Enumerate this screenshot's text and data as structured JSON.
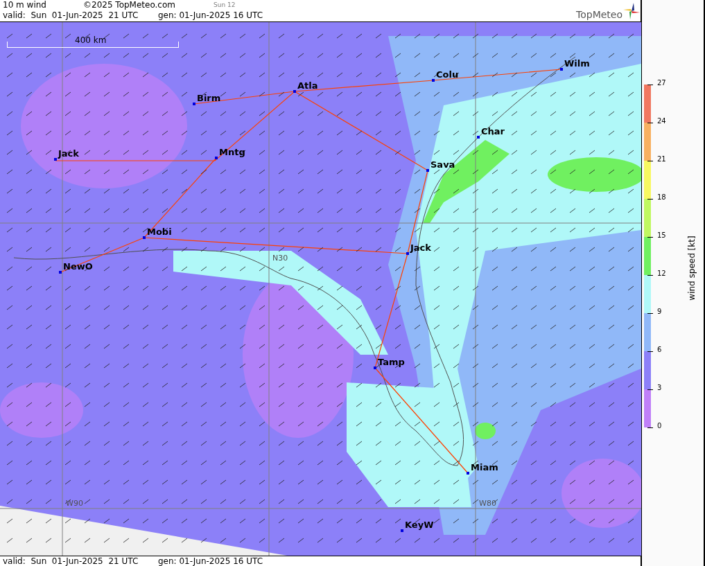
{
  "header": {
    "title": "10 m wind",
    "copyright": "©2025 TopMeteo.com",
    "step": "Sun 12",
    "valid": "valid:  Sun  01-Jun-2025  21 UTC",
    "generated": "gen: 01-Jun-2025 16 UTC",
    "logo": "TopMeteo"
  },
  "map": {
    "scale": "400 km",
    "cities": [
      {
        "name": "Atla"
      },
      {
        "name": "Colu"
      },
      {
        "name": "Wilm"
      },
      {
        "name": "Birm"
      },
      {
        "name": "Char"
      },
      {
        "name": "Jack"
      },
      {
        "name": "Mntg"
      },
      {
        "name": "Sava"
      },
      {
        "name": "Mobi"
      },
      {
        "name": "Jack"
      },
      {
        "name": "NewO"
      },
      {
        "name": "Tamp"
      },
      {
        "name": "Miam"
      },
      {
        "name": "KeyW"
      }
    ],
    "gridlabels": [
      "N30",
      "W90",
      "W80"
    ]
  },
  "colorbar": {
    "label": "wind speed [kt]",
    "ticks": [
      "27",
      "24",
      "21",
      "18",
      "15",
      "12",
      "9",
      "6",
      "3",
      "0"
    ],
    "bands": [
      {
        "color": "#f07860"
      },
      {
        "color": "#f8b060"
      },
      {
        "color": "#f8f860"
      },
      {
        "color": "#c0f860"
      },
      {
        "color": "#70f060"
      },
      {
        "color": "#b0f8f8"
      },
      {
        "color": "#90b8f8"
      },
      {
        "color": "#8c80f8"
      },
      {
        "color": "#c080f8"
      }
    ]
  },
  "footer": {
    "valid": "valid:  Sun  01-Jun-2025  21 UTC",
    "generated": "gen: 01-Jun-2025 16 UTC"
  }
}
